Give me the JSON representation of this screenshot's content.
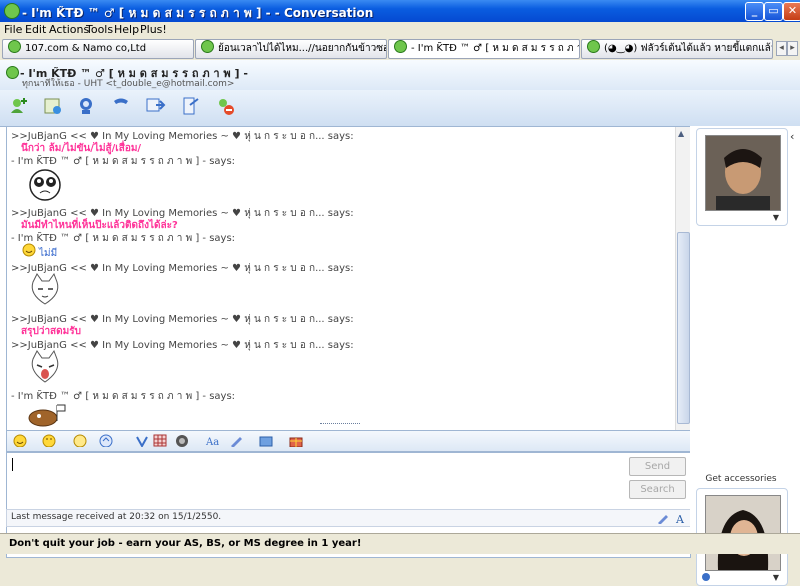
{
  "window": {
    "title": "- I'm K̃TÐ ™ ♂ [ ห ม ด ส ม ร ร ถ ภ า พ ] - - Conversation",
    "min": "_",
    "max": "▭",
    "close": "✕"
  },
  "menu": [
    "File",
    "Edit",
    "Actions",
    "Tools",
    "Help",
    "Plus!"
  ],
  "tabs": [
    {
      "label": "107.com & Namo co,Ltd"
    },
    {
      "label": "ย้อนเวลาไปได้ไหม...//นอยากกันข้าวซอย..."
    },
    {
      "label": "- I'm K̃TÐ ™ ♂ [ ห ม ด ส ม ร ร ถ ภ า..."
    },
    {
      "label": "(◕‿◕) ฟลัวร์เต้นได้แล้ว หายขี้แตกแล้วด้วย"
    }
  ],
  "tab_nav": [
    "◂",
    "▸"
  ],
  "contact": {
    "name": "- I'm K̃TÐ ™ ♂ [ ห ม ด ส ม ร ร ถ ภ า พ ] -",
    "subtitle": "ทุกนาทีให้เธอ - UHT <t_double_e@hotmail.com>"
  },
  "messages": [
    {
      "type": "sender",
      "text": ">>JuBjanG << ♥ In My Loving Memories ~  ♥ หุ่ น ก ร ะ บ อ ก... says:"
    },
    {
      "type": "pink",
      "text": "นึกว่า ล้ม/ไม่ขัน/ไม่สู้/เสื่อม/"
    },
    {
      "type": "sender",
      "text": "- I'm K̃TÐ ™ ♂ [ ห ม ด ส ม ร ร ถ ภ า พ ] - says:"
    },
    {
      "type": "sender",
      "text": ">>JuBjanG << ♥ In My Loving Memories ~  ♥ หุ่ น ก ร ะ บ อ ก... says:"
    },
    {
      "type": "pink",
      "text": "มันมีทำไหนที่เห็นป๊ะแล้วติดถึงได้ล่ะ?"
    },
    {
      "type": "sender",
      "text": "- I'm K̃TÐ ™ ♂ [ ห ม ด ส ม ร ร ถ ภ า พ ] - says:"
    },
    {
      "type": "plain",
      "text": "ไม่มี"
    },
    {
      "type": "sender",
      "text": ">>JuBjanG << ♥ In My Loving Memories ~  ♥ หุ่ น ก ร ะ บ อ ก... says:"
    },
    {
      "type": "sender",
      "text": ">>JuBjanG << ♥ In My Loving Memories ~  ♥ หุ่ น ก ร ะ บ อ ก... says:"
    },
    {
      "type": "pink",
      "text": "สรุปว่าสดมรับ"
    },
    {
      "type": "sender",
      "text": ">>JuBjanG << ♥ In My Loving Memories ~  ♥ หุ่ น ก ร ะ บ อ ก... says:"
    },
    {
      "type": "sender",
      "text": "- I'm K̃TÐ ™ ♂ [ ห ม ด ส ม ร ร ถ ภ า พ ] - says:"
    }
  ],
  "input": {
    "send": "Send",
    "search": "Search"
  },
  "status": "Last message received at 20:32 on 15/1/2550.",
  "accessories": "Get accessories",
  "ad": "Don't quit your job - earn your AS, BS, or MS degree in 1 year!",
  "colors": {
    "accent": "#0a5de0",
    "pink": "#ff3399",
    "panel": "#dde9f7"
  }
}
